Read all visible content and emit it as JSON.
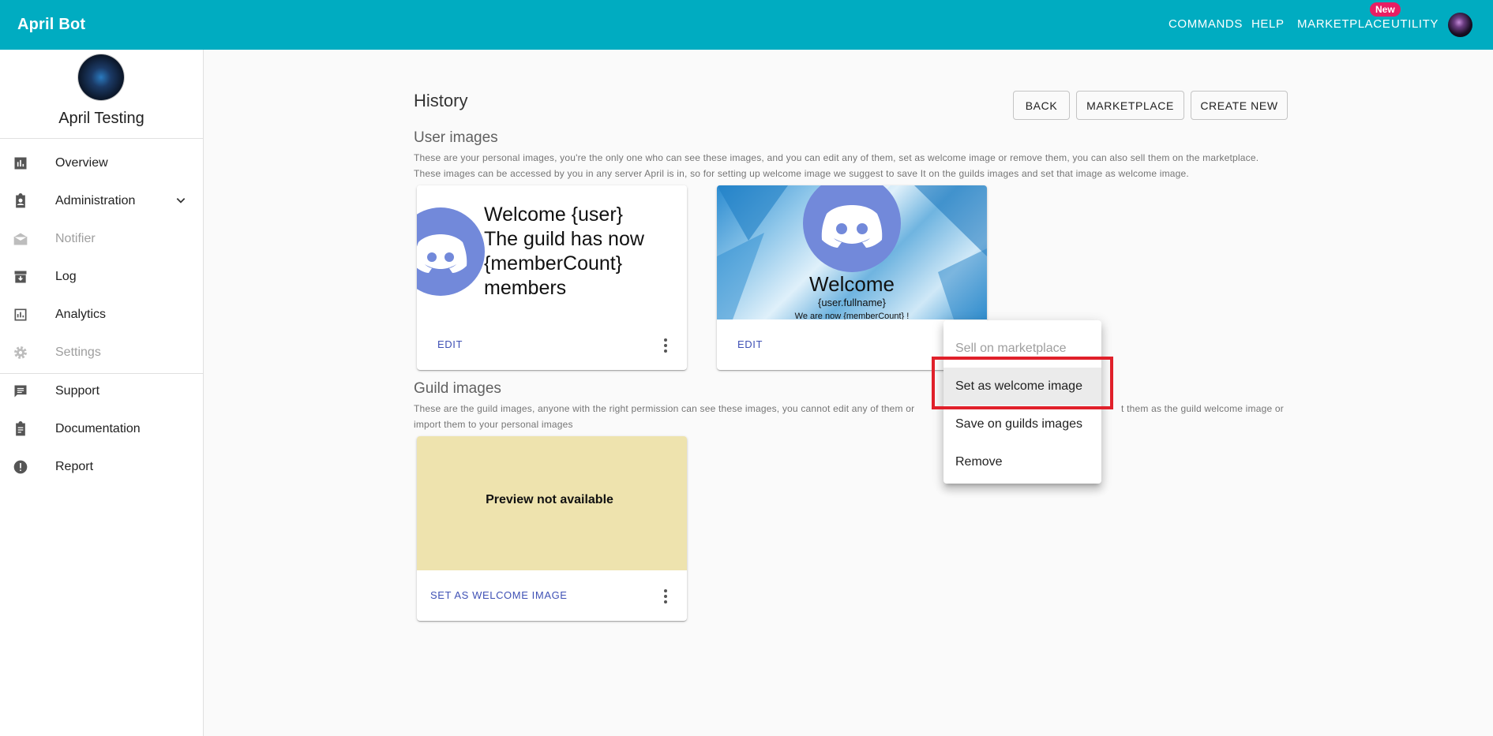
{
  "topbar": {
    "brand": "April Bot",
    "nav": [
      "COMMANDS",
      "HELP",
      "MARKETPLACE",
      "UTILITY"
    ],
    "new_badge": "New"
  },
  "sidebar": {
    "guild_name": "April Testing",
    "items": [
      {
        "label": "Overview",
        "icon": "bar-chart-icon",
        "disabled": false
      },
      {
        "label": "Administration",
        "icon": "clipboard-account-icon",
        "disabled": false,
        "expandable": true
      },
      {
        "label": "Notifier",
        "icon": "mail-open-icon",
        "disabled": true
      },
      {
        "label": "Log",
        "icon": "archive-icon",
        "disabled": false
      },
      {
        "label": "Analytics",
        "icon": "analytics-icon",
        "disabled": false
      },
      {
        "label": "Settings",
        "icon": "gear-icon",
        "disabled": true
      },
      {
        "label": "Support",
        "icon": "chat-icon",
        "disabled": false
      },
      {
        "label": "Documentation",
        "icon": "clipboard-text-icon",
        "disabled": false
      },
      {
        "label": "Report",
        "icon": "alert-circle-icon",
        "disabled": false
      }
    ]
  },
  "page": {
    "title": "History",
    "buttons": {
      "back": "BACK",
      "marketplace": "MARKETPLACE",
      "create_new": "CREATE NEW"
    }
  },
  "user_images": {
    "title": "User images",
    "desc_line1": "These are your personal images, you're the only one who can see these images, and you can edit any of them, set as welcome image or remove them, you can also sell them on the marketplace.",
    "desc_line2": "These images can be accessed by you in any server April is in, so for setting up welcome image we suggest to save It on the guilds images and set that image as welcome image.",
    "cards": [
      {
        "preview_text": [
          "Welcome {user}",
          "The guild has now",
          "{memberCount}",
          "members"
        ],
        "action": "EDIT"
      },
      {
        "preview_title": "Welcome",
        "preview_sub": "{user.fullname}",
        "preview_sub2": "We are now {memberCount} !",
        "action": "EDIT"
      }
    ]
  },
  "guild_images": {
    "title": "Guild images",
    "desc_line1_a": "These are the guild images, anyone with the right permission can see these images, you cannot edit any of them or",
    "desc_line1_b": "t them as the guild welcome image or",
    "desc_line2": "import them to your personal images",
    "cards": [
      {
        "preview_text": "Preview not available",
        "action": "SET AS WELCOME IMAGE"
      }
    ]
  },
  "context_menu": {
    "items": [
      {
        "label": "Sell on marketplace",
        "disabled": true
      },
      {
        "label": "Set as welcome image",
        "disabled": false,
        "highlighted": true
      },
      {
        "label": "Save on guilds images",
        "disabled": false
      },
      {
        "label": "Remove",
        "disabled": false
      }
    ]
  },
  "colors": {
    "topbar": "#00acc1",
    "accent": "#3f51b5",
    "badge": "#e91e63",
    "discord": "#7289da",
    "highlight": "#e0202a",
    "preview_bg": "#eee3ae"
  }
}
